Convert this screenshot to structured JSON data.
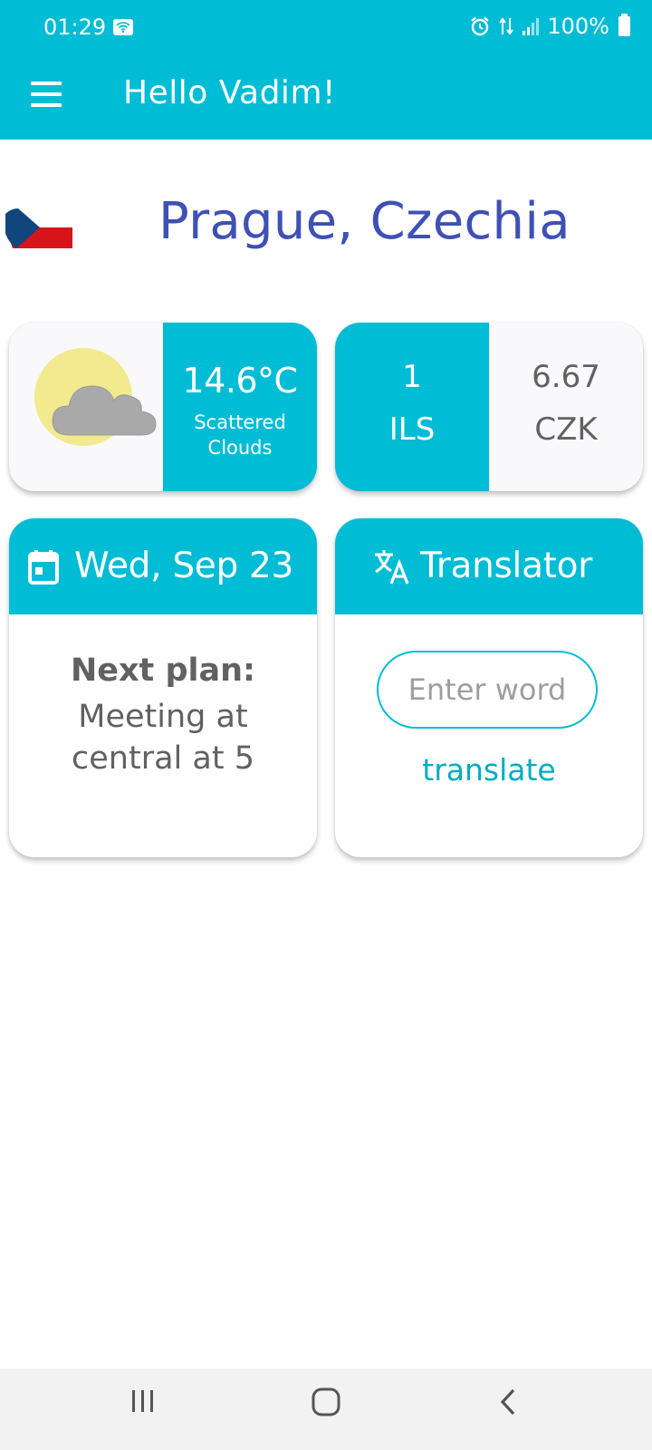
{
  "status_bar": {
    "time": "01:29",
    "battery_text": "100%",
    "icons": [
      "wifi-icon",
      "alarm-icon",
      "data-arrows-icon",
      "signal-icon",
      "battery-icon"
    ]
  },
  "app_bar": {
    "title": "Hello Vadim!",
    "menu_icon": "menu-icon",
    "background": "#00bcd4"
  },
  "location": {
    "city": "Prague, Czechia",
    "flag": "czech-flag",
    "city_color": "#3f51b5"
  },
  "weather": {
    "temperature": "14.6°C",
    "description_line1": "Scattered",
    "description_line2": "Clouds",
    "icon": "partly-cloudy-icon"
  },
  "currency": {
    "from_amount": "1",
    "from_code": "ILS",
    "to_amount": "6.67",
    "to_code": "CZK"
  },
  "date_card": {
    "date": "Wed, Sep 23",
    "icon": "calendar-icon",
    "plan_label": "Next plan:",
    "plan_text": "Meeting at central at 5"
  },
  "translator": {
    "title": "Translator",
    "icon": "translate-icon",
    "input_placeholder": "Enter word",
    "input_value": "",
    "button_label": "translate"
  },
  "nav_bar": {
    "icons": [
      "recent-apps-icon",
      "home-icon",
      "back-icon"
    ]
  },
  "colors": {
    "accent": "#00bcd4",
    "text_gray": "#616161"
  }
}
